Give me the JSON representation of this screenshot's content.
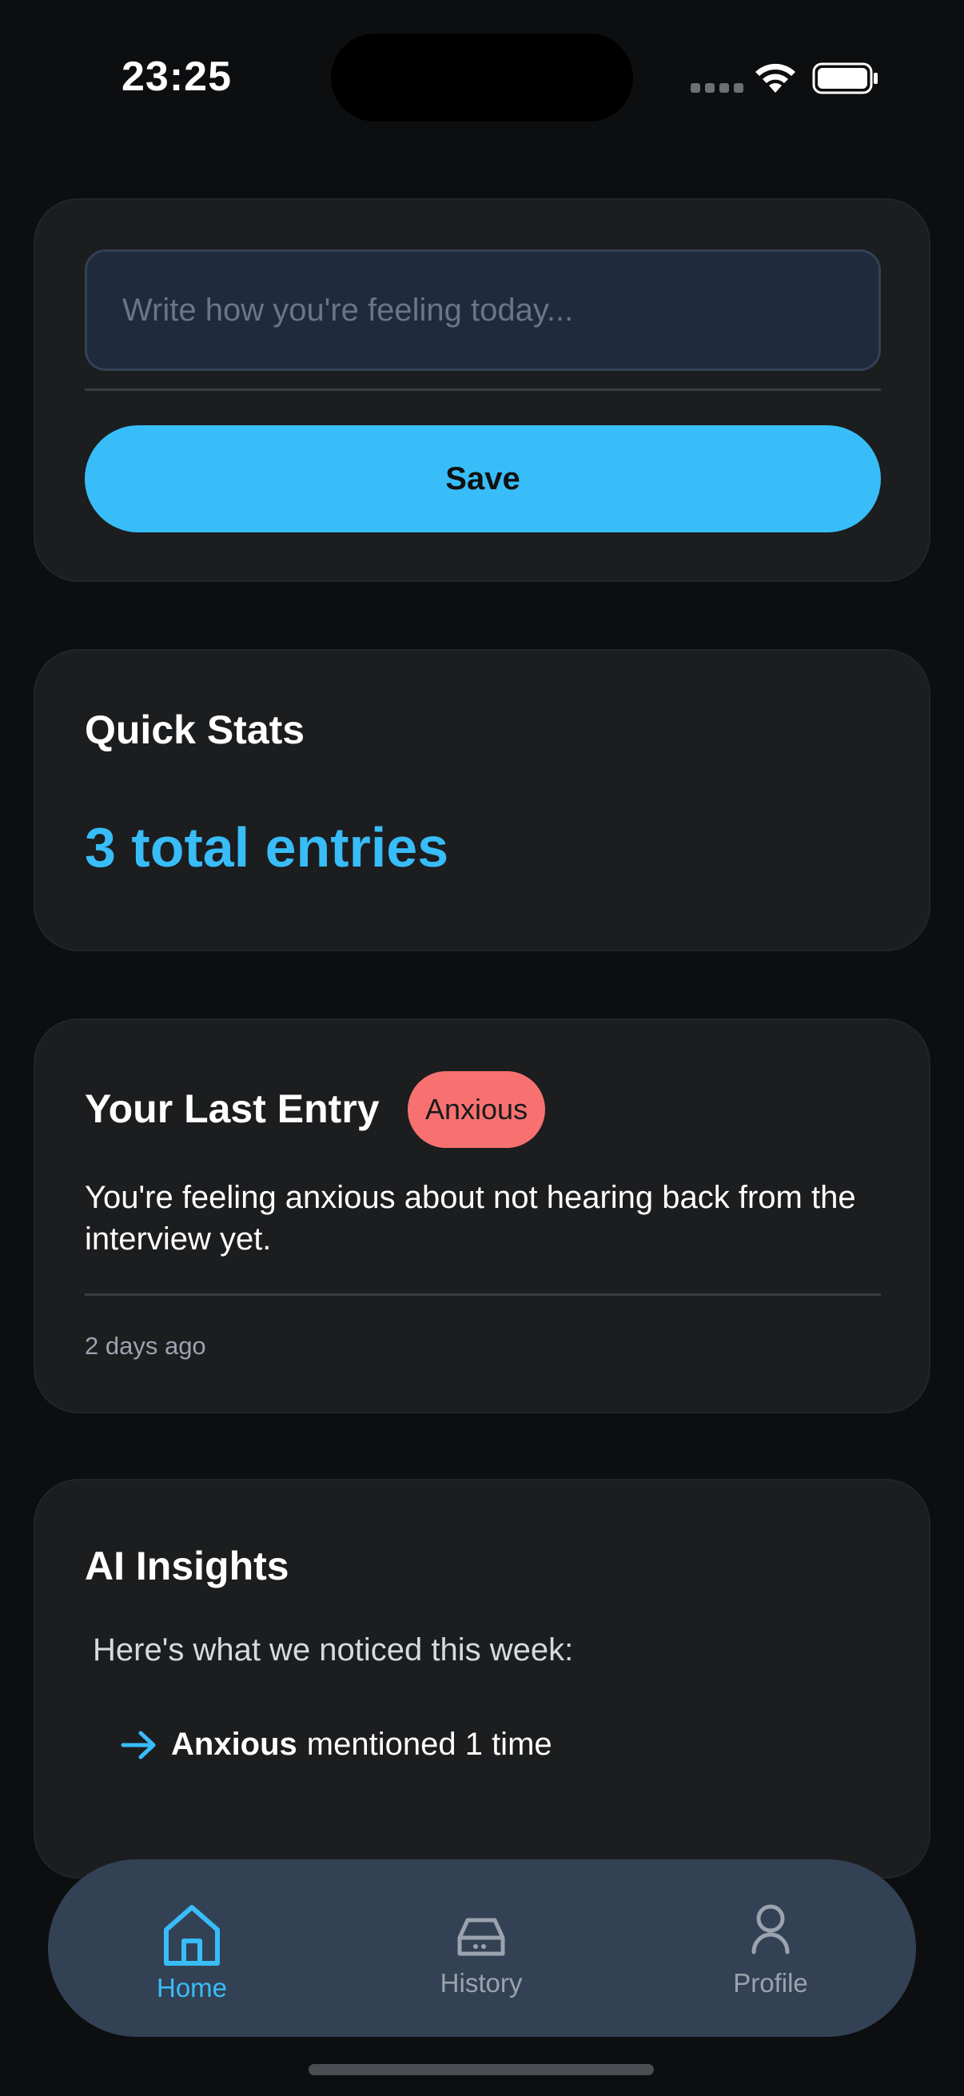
{
  "status_bar": {
    "time": "23:25",
    "icons": [
      "cellular-signal-icon",
      "wifi-icon",
      "battery-icon"
    ]
  },
  "entry": {
    "placeholder": "Write how you're feeling today...",
    "save_label": "Save"
  },
  "quick_stats": {
    "title": "Quick Stats",
    "value": "3 total entries"
  },
  "last_entry": {
    "title": "Your Last Entry",
    "mood": "Anxious",
    "text": "You're feeling anxious about not hearing back from the interview yet.",
    "time": "2 days ago"
  },
  "ai_insights": {
    "title": "AI Insights",
    "intro": "Here's what we noticed this week:",
    "items": [
      {
        "mood": "Anxious",
        "text": "mentioned 1 time"
      }
    ]
  },
  "nav": {
    "items": [
      {
        "label": "Home",
        "icon": "home-icon",
        "active": true
      },
      {
        "label": "History",
        "icon": "inbox-icon",
        "active": false
      },
      {
        "label": "Profile",
        "icon": "user-icon",
        "active": false
      }
    ]
  },
  "colors": {
    "background": "#0d0e10",
    "card": "#1c1d1f",
    "accent": "#38bdf8",
    "badge_anxious": "#f87171",
    "nav_bar": "#334155"
  }
}
